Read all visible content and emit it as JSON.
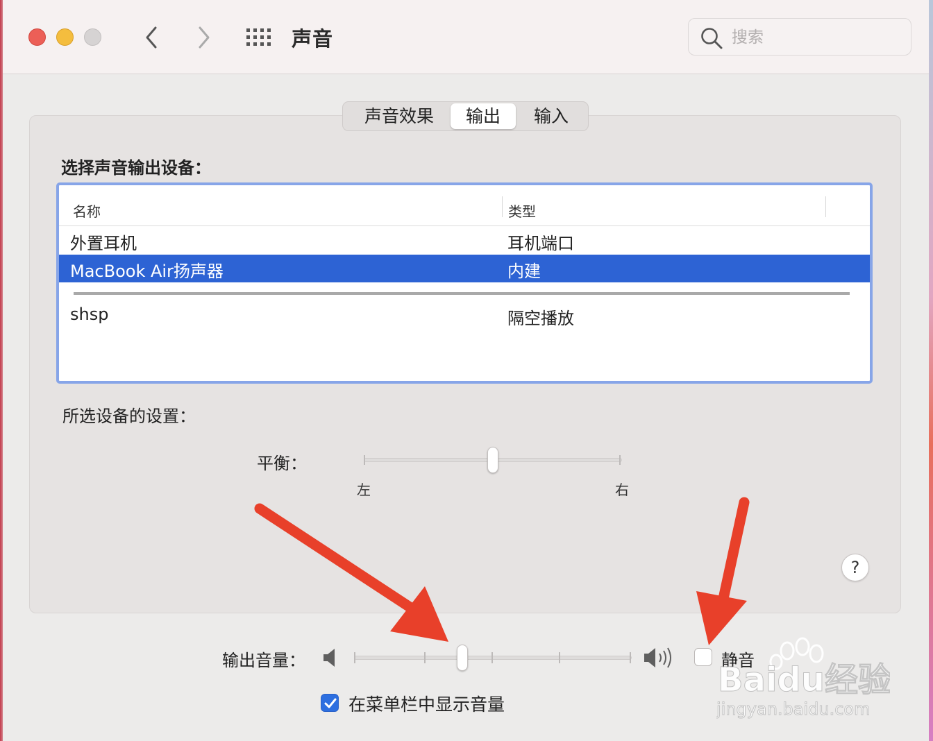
{
  "window": {
    "title": "声音",
    "search": {
      "placeholder": "搜索",
      "value": ""
    }
  },
  "tabs": [
    {
      "label": "声音效果",
      "selected": false
    },
    {
      "label": "输出",
      "selected": true
    },
    {
      "label": "输入",
      "selected": false
    }
  ],
  "output": {
    "section_label": "选择声音输出设备：",
    "table": {
      "columns": [
        "名称",
        "类型"
      ],
      "rows": [
        {
          "name": "外置耳机",
          "type": "耳机端口",
          "selected": false
        },
        {
          "name": "MacBook Air扬声器",
          "type": "内建",
          "selected": true
        },
        {
          "name": "shsp",
          "type": "隔空播放",
          "selected": false
        }
      ]
    },
    "settings_label": "所选设备的设置：",
    "balance": {
      "label": "平衡：",
      "left_label": "左",
      "right_label": "右",
      "value": 0.5
    },
    "help_label": "?"
  },
  "footer": {
    "volume_label": "输出音量：",
    "volume_value": 0.39,
    "mute_label": "静音",
    "mute_checked": false,
    "show_in_menubar_label": "在菜单栏中显示音量",
    "show_in_menubar_checked": true
  },
  "watermark": {
    "brand": "Baidu经验",
    "url": "jingyan.baidu.com"
  },
  "colors": {
    "selection": "#2d63d4",
    "focus_ring": "#87a5e8",
    "checkbox_on": "#2d6fe0",
    "annotation_arrow": "#e8402a"
  },
  "icons": [
    "back-chevron-icon",
    "forward-chevron-icon",
    "grid-icon",
    "search-icon",
    "volume-low-icon",
    "volume-high-icon",
    "checkmark-icon"
  ]
}
